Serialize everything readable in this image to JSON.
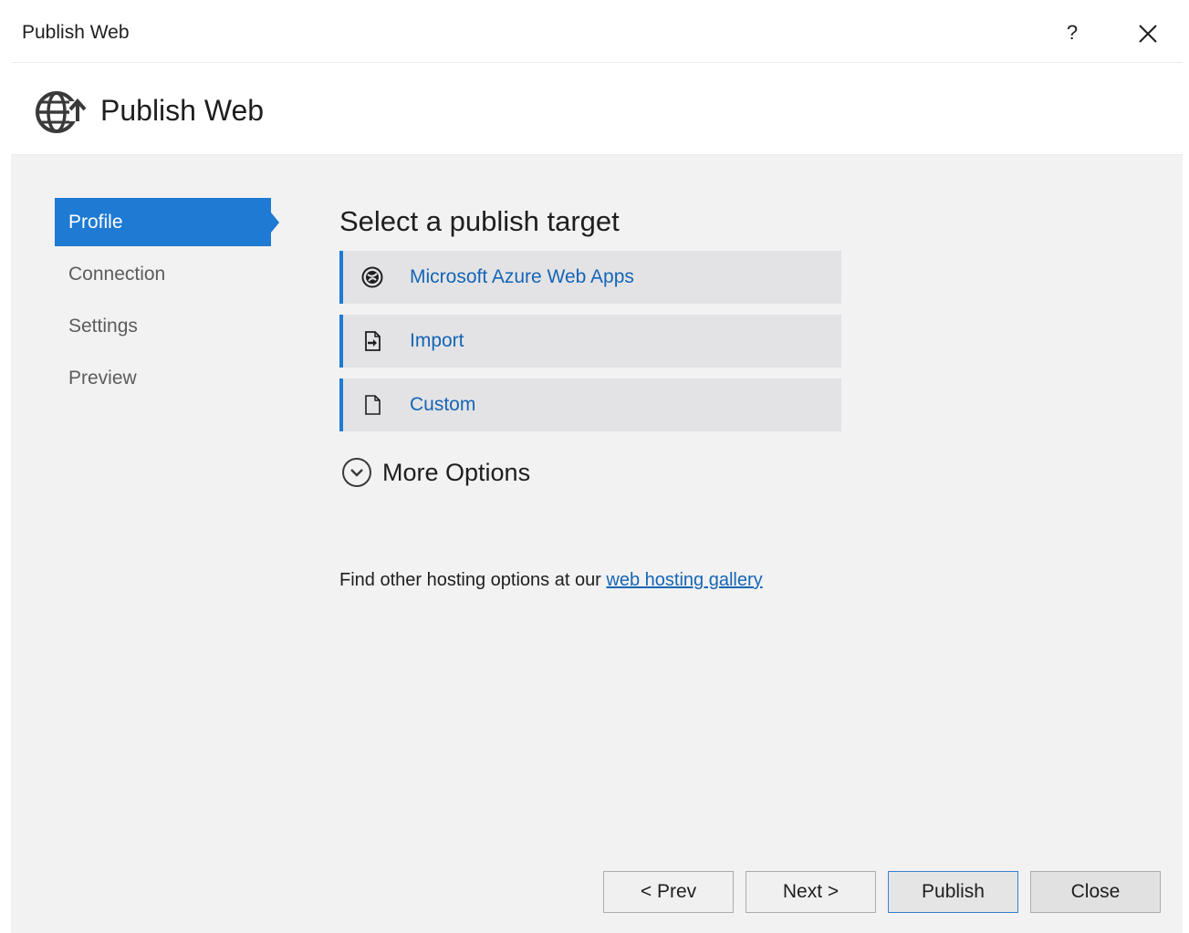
{
  "window": {
    "title": "Publish Web",
    "help_label": "?"
  },
  "header": {
    "title": "Publish Web"
  },
  "nav": {
    "items": [
      {
        "label": "Profile"
      },
      {
        "label": "Connection"
      },
      {
        "label": "Settings"
      },
      {
        "label": "Preview"
      }
    ],
    "active": "Profile"
  },
  "main": {
    "section_title": "Select a publish target",
    "targets": [
      {
        "label": "Microsoft Azure Web Apps",
        "icon": "azure-icon"
      },
      {
        "label": "Import",
        "icon": "import-icon"
      },
      {
        "label": "Custom",
        "icon": "document-icon"
      }
    ],
    "more_options_label": "More Options",
    "hosting_text": "Find other hosting options at our ",
    "hosting_link": "web hosting gallery"
  },
  "footer": {
    "prev_label": "< Prev",
    "next_label": "Next >",
    "publish_label": "Publish",
    "close_label": "Close"
  },
  "colors": {
    "accent": "#1e7ad3",
    "link": "#1565b5",
    "panel_bg": "#f2f2f2",
    "target_bg": "#e3e3e6"
  }
}
